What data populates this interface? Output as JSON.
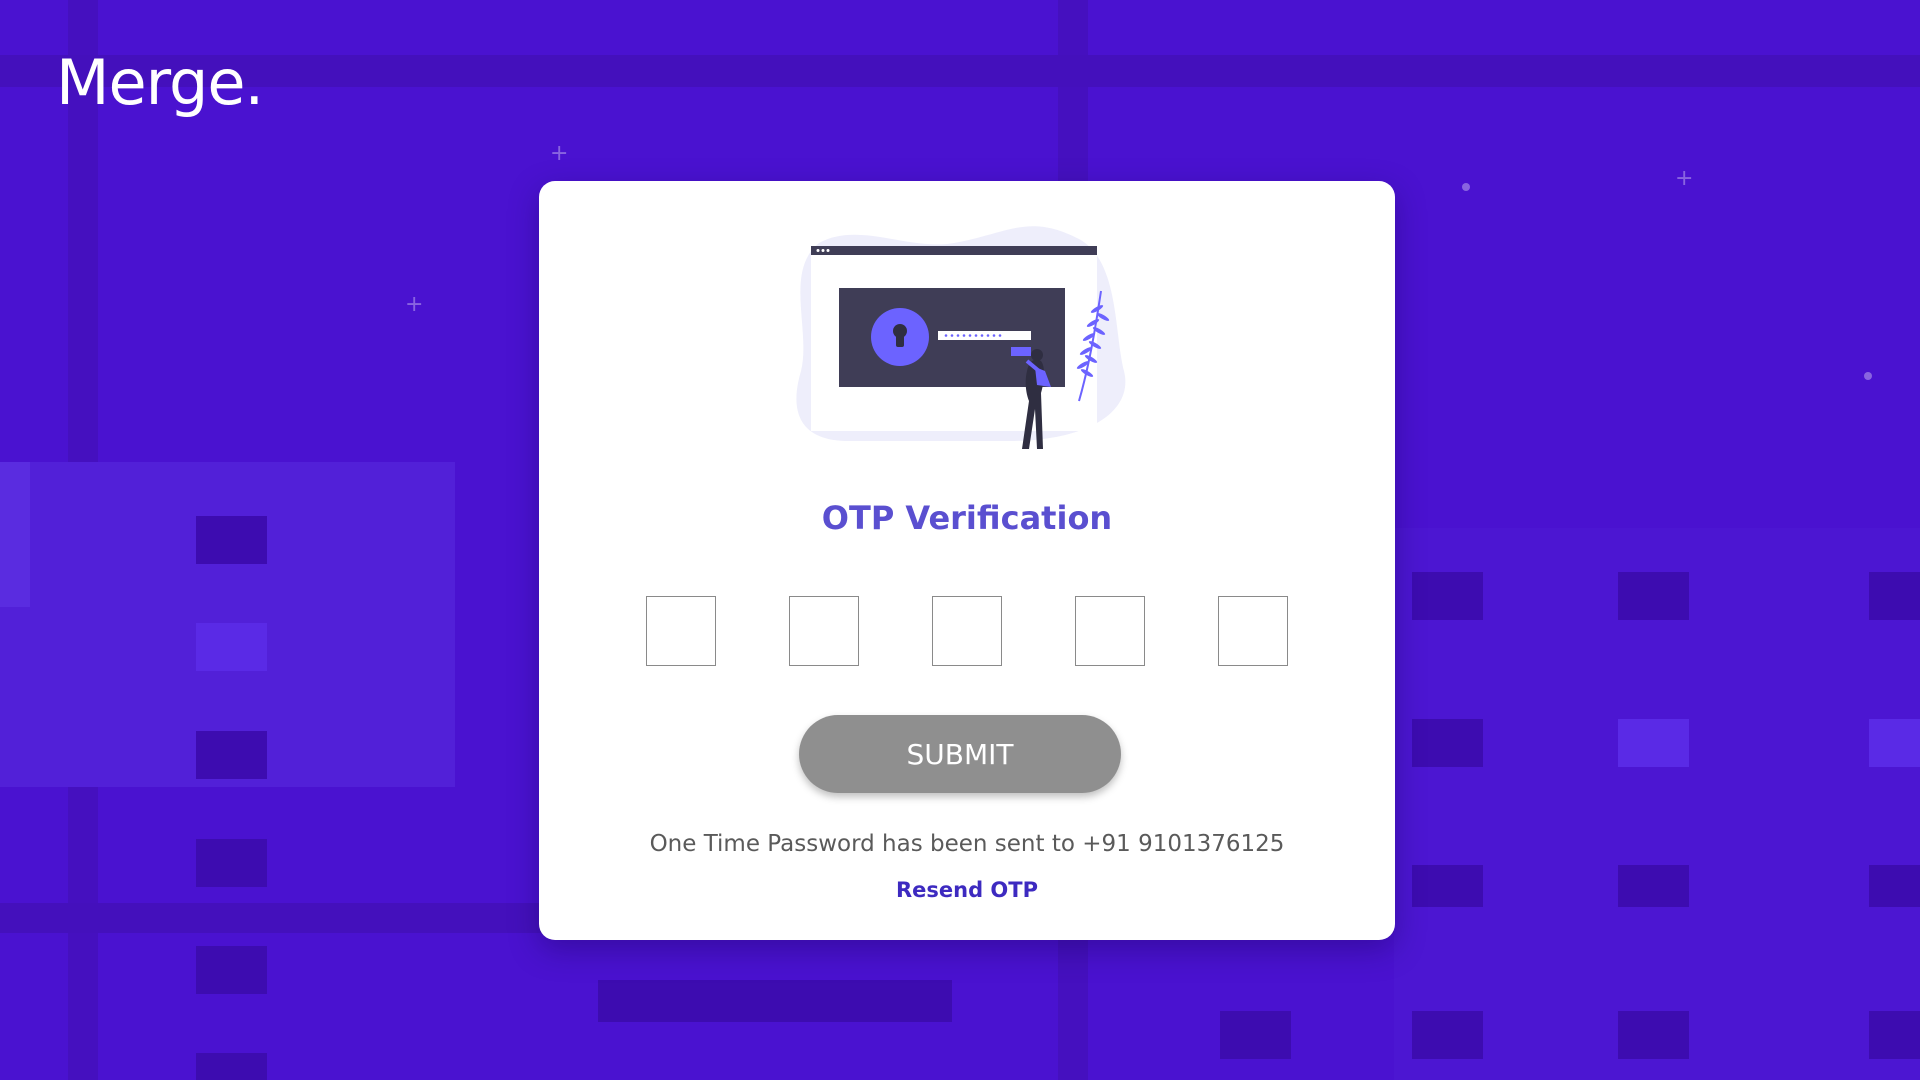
{
  "app": {
    "logo_text": "Merge."
  },
  "card": {
    "illustration_icon": "lock-screen-illustration",
    "title": "OTP Verification",
    "otp_digits": [
      "",
      "",
      "",
      "",
      ""
    ],
    "submit_label": "SUBMIT",
    "sent_message": "One Time Password has been sent to +91 9101376125",
    "resend_label": "Resend OTP"
  },
  "colors": {
    "background": "#4a12d0",
    "accent": "#5a4fd0",
    "link": "#3d2ac0",
    "submit_button": "#8f8f8f"
  }
}
